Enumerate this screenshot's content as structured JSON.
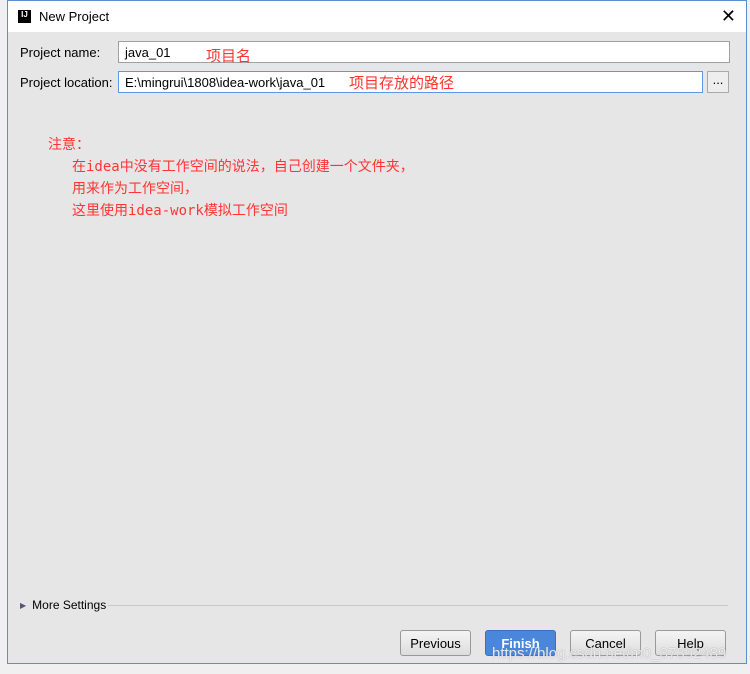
{
  "window": {
    "title": "New Project",
    "close_icon": "close-icon"
  },
  "form": {
    "name_label": "Project name:",
    "name_value": "java_01",
    "location_label": "Project location:",
    "location_value": "E:\\mingrui\\1808\\idea-work\\java_01",
    "browse_label": "..."
  },
  "annotations": {
    "name_note": "项目名",
    "location_note": "项目存放的路径",
    "note_lines": [
      "注意：",
      "在idea中没有工作空间的说法，自己创建一个文件夹，",
      "用来作为工作空间，",
      "这里使用idea-work模拟工作空间"
    ]
  },
  "more_settings": "More Settings",
  "buttons": {
    "previous": "Previous",
    "finish": "Finish",
    "cancel": "Cancel",
    "help": "Help"
  },
  "watermark": "https://blog.csdn.net/m0_37392489"
}
